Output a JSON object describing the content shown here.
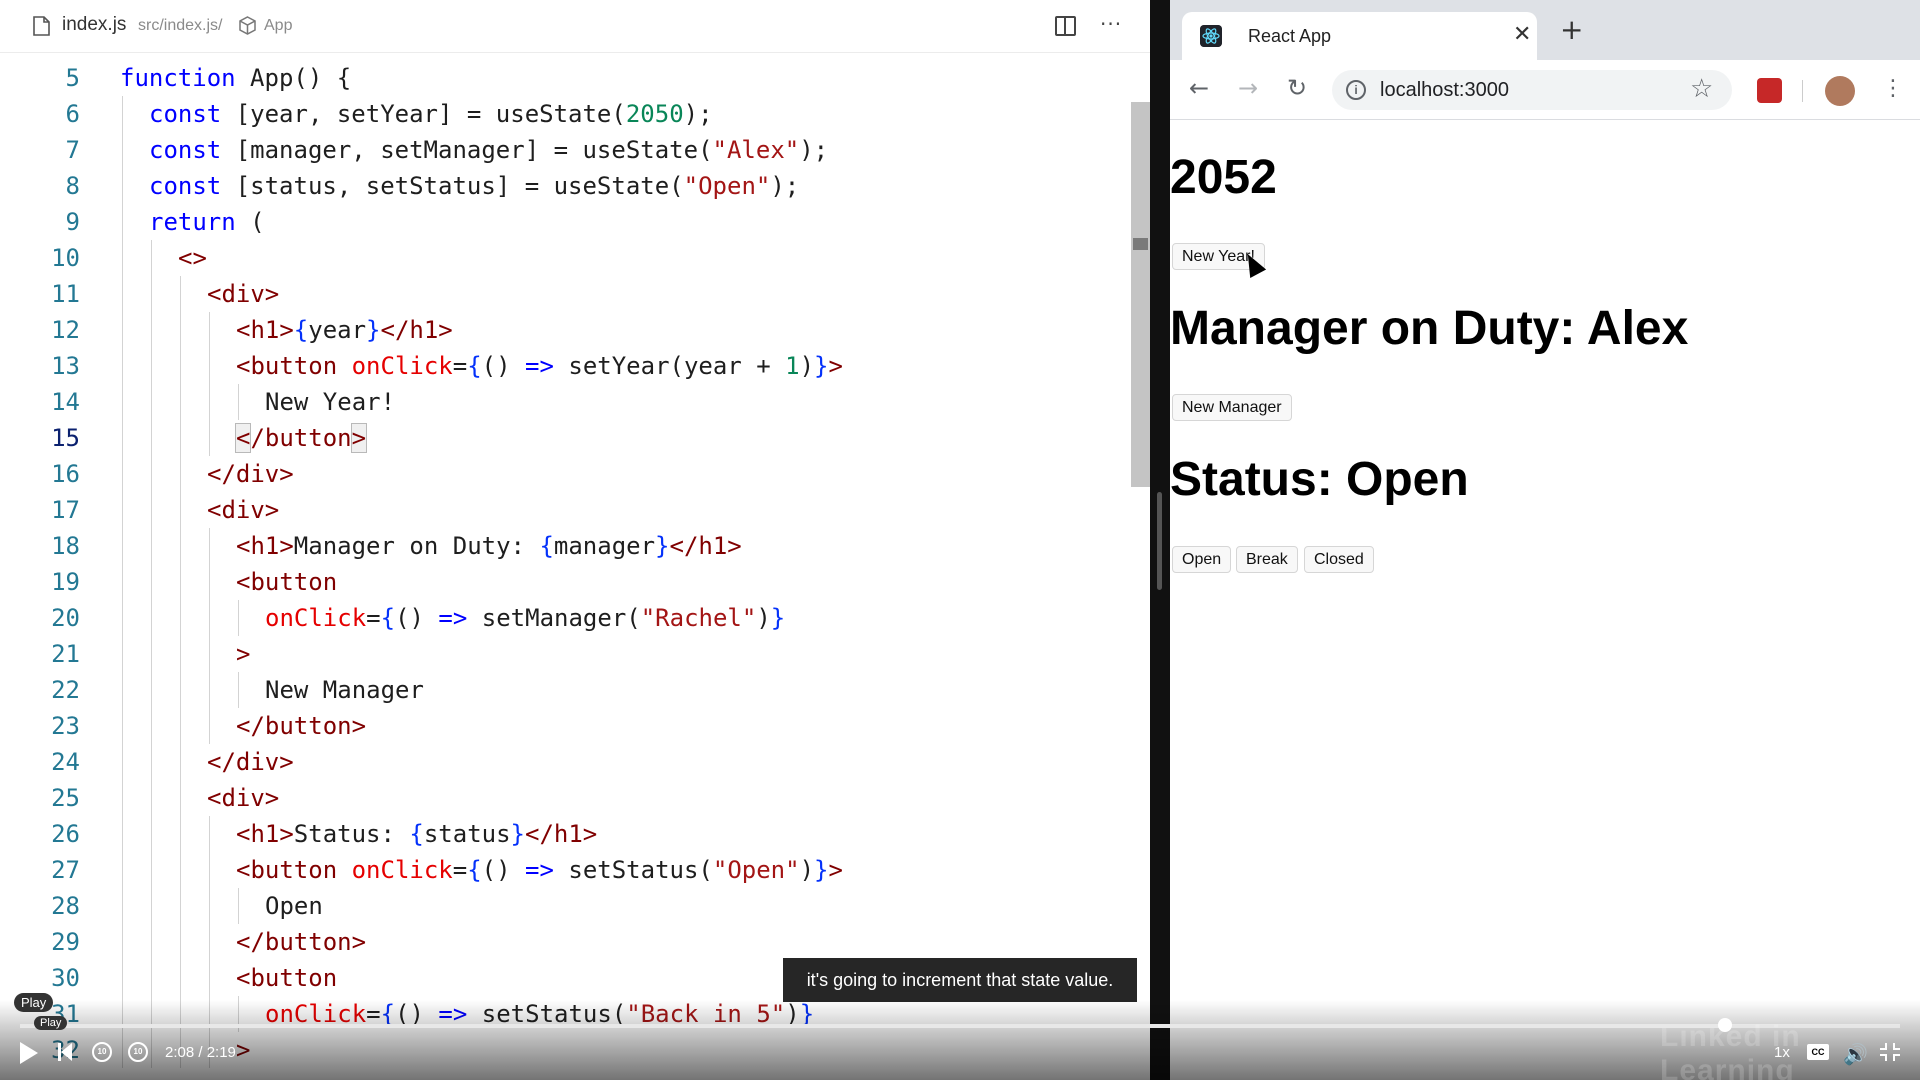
{
  "editor": {
    "filename": "index.js",
    "path": "src/index.js/",
    "symbol": "App",
    "active_line": 15,
    "lines": [
      {
        "n": 5,
        "indent": 0,
        "tokens": [
          [
            "kw",
            "function "
          ],
          [
            "fn",
            "App() {"
          ]
        ]
      },
      {
        "n": 6,
        "indent": 1,
        "tokens": [
          [
            "kw",
            "const "
          ],
          [
            "fn",
            "[year, setYear] = useState("
          ],
          [
            "num",
            "2050"
          ],
          [
            "fn",
            ");"
          ]
        ]
      },
      {
        "n": 7,
        "indent": 1,
        "tokens": [
          [
            "kw",
            "const "
          ],
          [
            "fn",
            "[manager, setManager] = useState("
          ],
          [
            "str",
            "\"Alex\""
          ],
          [
            "fn",
            ");"
          ]
        ]
      },
      {
        "n": 8,
        "indent": 1,
        "tokens": [
          [
            "kw",
            "const "
          ],
          [
            "fn",
            "[status, setStatus] = useState("
          ],
          [
            "str",
            "\"Open\""
          ],
          [
            "fn",
            ");"
          ]
        ]
      },
      {
        "n": 9,
        "indent": 1,
        "tokens": [
          [
            "kw",
            "return "
          ],
          [
            "fn",
            "("
          ]
        ]
      },
      {
        "n": 10,
        "indent": 2,
        "tokens": [
          [
            "tag",
            "<>"
          ]
        ]
      },
      {
        "n": 11,
        "indent": 3,
        "tokens": [
          [
            "tag",
            "<div>"
          ]
        ]
      },
      {
        "n": 12,
        "indent": 4,
        "tokens": [
          [
            "tag",
            "<h1>"
          ],
          [
            "brace",
            "{"
          ],
          [
            "fn",
            "year"
          ],
          [
            "brace",
            "}"
          ],
          [
            "tag",
            "</h1>"
          ]
        ]
      },
      {
        "n": 13,
        "indent": 4,
        "tokens": [
          [
            "tag",
            "<button "
          ],
          [
            "attr",
            "onClick"
          ],
          [
            "fn",
            "="
          ],
          [
            "brace",
            "{"
          ],
          [
            "fn",
            "() "
          ],
          [
            "arrow",
            "=>"
          ],
          [
            "fn",
            " setYear(year + "
          ],
          [
            "num",
            "1"
          ],
          [
            "fn",
            ")"
          ],
          [
            "brace",
            "}"
          ],
          [
            "tag",
            ">"
          ]
        ]
      },
      {
        "n": 14,
        "indent": 5,
        "tokens": [
          [
            "fn",
            "New Year!"
          ]
        ]
      },
      {
        "n": 15,
        "indent": 4,
        "tokens": [
          [
            "tag",
            "</button>"
          ]
        ]
      },
      {
        "n": 16,
        "indent": 3,
        "tokens": [
          [
            "tag",
            "</div>"
          ]
        ]
      },
      {
        "n": 17,
        "indent": 3,
        "tokens": [
          [
            "tag",
            "<div>"
          ]
        ]
      },
      {
        "n": 18,
        "indent": 4,
        "tokens": [
          [
            "tag",
            "<h1>"
          ],
          [
            "fn",
            "Manager on Duty: "
          ],
          [
            "brace",
            "{"
          ],
          [
            "fn",
            "manager"
          ],
          [
            "brace",
            "}"
          ],
          [
            "tag",
            "</h1>"
          ]
        ]
      },
      {
        "n": 19,
        "indent": 4,
        "tokens": [
          [
            "tag",
            "<button"
          ]
        ]
      },
      {
        "n": 20,
        "indent": 5,
        "tokens": [
          [
            "attr",
            "onClick"
          ],
          [
            "fn",
            "="
          ],
          [
            "brace",
            "{"
          ],
          [
            "fn",
            "() "
          ],
          [
            "arrow",
            "=>"
          ],
          [
            "fn",
            " setManager("
          ],
          [
            "str",
            "\"Rachel\""
          ],
          [
            "fn",
            ")"
          ],
          [
            "brace",
            "}"
          ]
        ]
      },
      {
        "n": 21,
        "indent": 4,
        "tokens": [
          [
            "tag",
            ">"
          ]
        ]
      },
      {
        "n": 22,
        "indent": 5,
        "tokens": [
          [
            "fn",
            "New Manager"
          ]
        ]
      },
      {
        "n": 23,
        "indent": 4,
        "tokens": [
          [
            "tag",
            "</button>"
          ]
        ]
      },
      {
        "n": 24,
        "indent": 3,
        "tokens": [
          [
            "tag",
            "</div>"
          ]
        ]
      },
      {
        "n": 25,
        "indent": 3,
        "tokens": [
          [
            "tag",
            "<div>"
          ]
        ]
      },
      {
        "n": 26,
        "indent": 4,
        "tokens": [
          [
            "tag",
            "<h1>"
          ],
          [
            "fn",
            "Status: "
          ],
          [
            "brace",
            "{"
          ],
          [
            "fn",
            "status"
          ],
          [
            "brace",
            "}"
          ],
          [
            "tag",
            "</h1>"
          ]
        ]
      },
      {
        "n": 27,
        "indent": 4,
        "tokens": [
          [
            "tag",
            "<button "
          ],
          [
            "attr",
            "onClick"
          ],
          [
            "fn",
            "="
          ],
          [
            "brace",
            "{"
          ],
          [
            "fn",
            "() "
          ],
          [
            "arrow",
            "=>"
          ],
          [
            "fn",
            " setStatus("
          ],
          [
            "str",
            "\"Open\""
          ],
          [
            "fn",
            ")"
          ],
          [
            "brace",
            "}"
          ],
          [
            "tag",
            ">"
          ]
        ]
      },
      {
        "n": 28,
        "indent": 5,
        "tokens": [
          [
            "fn",
            "Open"
          ]
        ]
      },
      {
        "n": 29,
        "indent": 4,
        "tokens": [
          [
            "tag",
            "</button>"
          ]
        ]
      },
      {
        "n": 30,
        "indent": 4,
        "tokens": [
          [
            "tag",
            "<button"
          ]
        ]
      },
      {
        "n": 31,
        "indent": 5,
        "tokens": [
          [
            "attr",
            "onClick"
          ],
          [
            "fn",
            "="
          ],
          [
            "brace",
            "{"
          ],
          [
            "fn",
            "() "
          ],
          [
            "arrow",
            "=>"
          ],
          [
            "fn",
            " setStatus("
          ],
          [
            "str",
            "\"Back in 5\""
          ],
          [
            "fn",
            ")"
          ],
          [
            "brace",
            "}"
          ]
        ]
      },
      {
        "n": 32,
        "indent": 4,
        "tokens": [
          [
            "tag",
            ">"
          ]
        ]
      }
    ]
  },
  "browser": {
    "tab_title": "React App",
    "url": "localhost:3000",
    "info_glyph": "i",
    "app": {
      "year": "2052",
      "new_year_label": "New Year!",
      "manager_heading": "Manager on Duty: Alex",
      "new_manager_label": "New Manager",
      "status_heading": "Status: Open",
      "status_buttons": [
        "Open",
        "Break",
        "Closed"
      ]
    }
  },
  "player": {
    "caption": "it's going to increment that state value.",
    "play_tooltip": "Play",
    "play_tooltip_small": "Play",
    "time": "2:08 / 2:19",
    "progress": 0.907,
    "speed": "1x",
    "cc": "CC",
    "skip_back_label": "10",
    "skip_fwd_label": "10",
    "watermark": "Linked in Learning"
  },
  "icons": [
    "file-icon",
    "cube-icon",
    "split-editor-icon",
    "more-icon",
    "react-favicon",
    "close-tab-icon",
    "new-tab-icon",
    "back-icon",
    "forward-icon",
    "reload-icon",
    "info-icon",
    "star-icon",
    "extension-icon",
    "avatar",
    "kebab-menu-icon",
    "mouse-cursor-icon",
    "play-icon",
    "previous-icon",
    "rewind-10-icon",
    "forward-10-icon",
    "cc-icon",
    "volume-icon",
    "fullscreen-exit-icon"
  ],
  "colors": {
    "keyword": "#0000ff",
    "string": "#a31515",
    "number": "#098658",
    "tag": "#800000",
    "attribute": "#e50000",
    "brace": "#0431fa",
    "line_number": "#237893"
  }
}
